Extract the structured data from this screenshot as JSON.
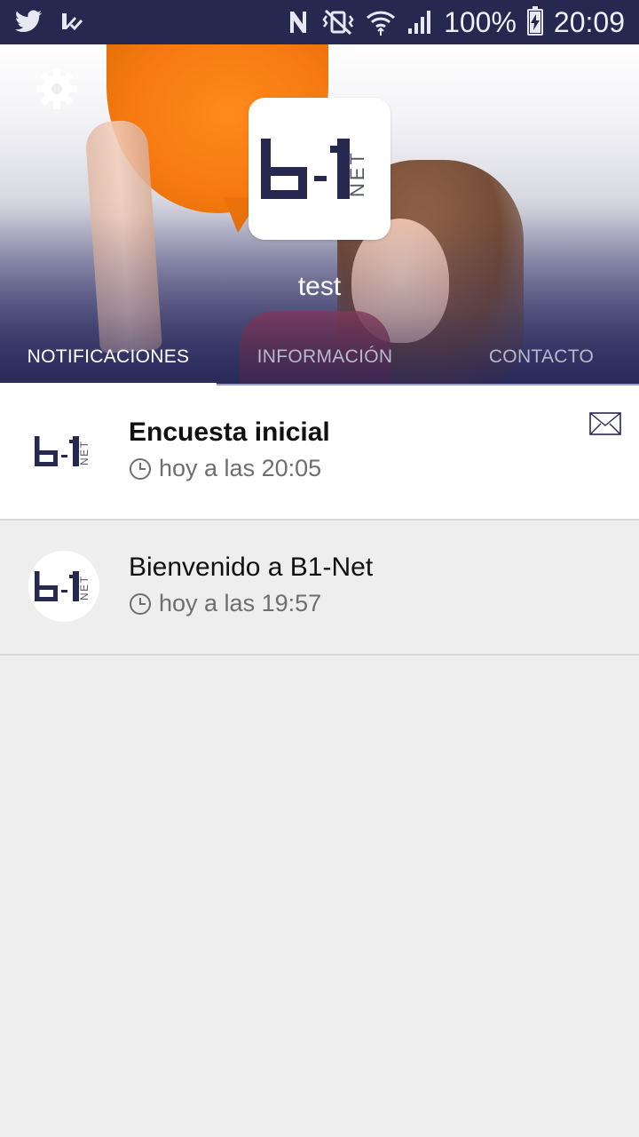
{
  "status_bar": {
    "left_icons": [
      "twitter-icon",
      "checkmark-notification-icon"
    ],
    "right_icons": [
      "nfc-icon",
      "vibrate-mute-icon",
      "wifi-icon",
      "signal-icon"
    ],
    "battery": "100%",
    "time": "20:09"
  },
  "header": {
    "app_name": "test",
    "settings_icon": "gear-icon",
    "logo": {
      "main": "b-1",
      "sub": "NET"
    }
  },
  "tabs": [
    {
      "label": "NOTIFICACIONES",
      "active": true
    },
    {
      "label": "INFORMACIÓN",
      "active": false
    },
    {
      "label": "CONTACTO",
      "active": false
    }
  ],
  "notifications": [
    {
      "title": "Encuesta inicial",
      "time": "hoy a las 20:05",
      "unread": true,
      "icon": "envelope-icon"
    },
    {
      "title": "Bienvenido a B1-Net",
      "time": "hoy a las 19:57",
      "unread": false
    }
  ],
  "colors": {
    "status_bar": "#262850",
    "brand_navy": "#262850",
    "accent_orange": "#f67a10"
  }
}
